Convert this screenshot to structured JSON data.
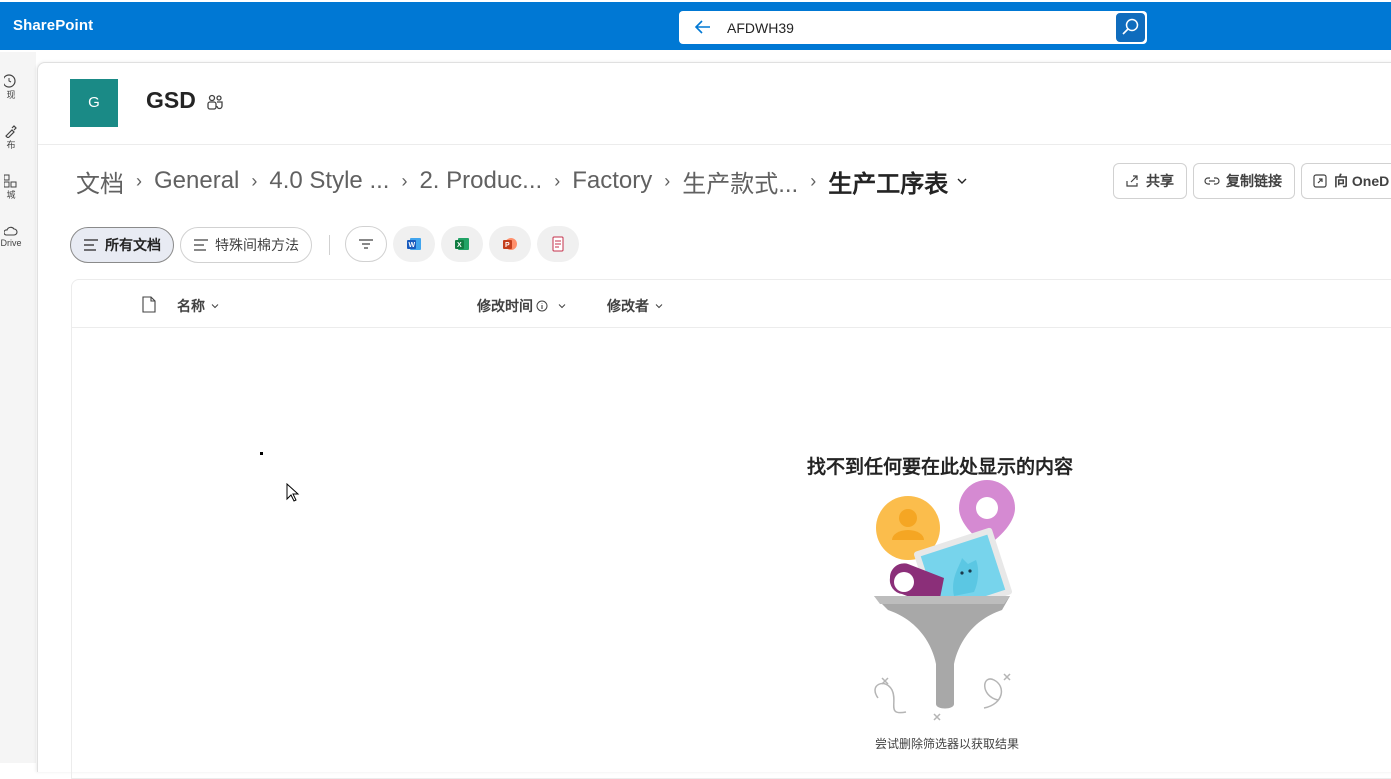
{
  "topbar": {
    "brand": "SharePoint",
    "search": {
      "value": "AFDWH39"
    }
  },
  "leftrail": {
    "items": [
      {
        "label": "现",
        "icon": "home-icon"
      },
      {
        "label": "布",
        "icon": "create-icon"
      },
      {
        "label": "城",
        "icon": "apps-icon"
      },
      {
        "label": "Drive",
        "icon": "cloud-icon"
      }
    ]
  },
  "site": {
    "logo_letter": "G",
    "title": "GSD"
  },
  "breadcrumb": {
    "items": [
      "文档",
      "General",
      "4.0 Style ...",
      "2. Produc...",
      "Factory",
      "生产款式..."
    ],
    "current": "生产工序表"
  },
  "commands": {
    "share": "共享",
    "copy_link": "复制链接",
    "onedrive": "向 OneD"
  },
  "views": {
    "all_docs": "所有文档",
    "special": "特殊间棉方法"
  },
  "columns": {
    "name": "名称",
    "modified": "修改时间",
    "modified_by": "修改者"
  },
  "empty_state": {
    "title": "找不到任何要在此处显示的内容",
    "subtitle": "尝试删除筛选器以获取结果"
  },
  "colors": {
    "topbar": "#0078d4",
    "site_logo": "#1a8a86"
  }
}
